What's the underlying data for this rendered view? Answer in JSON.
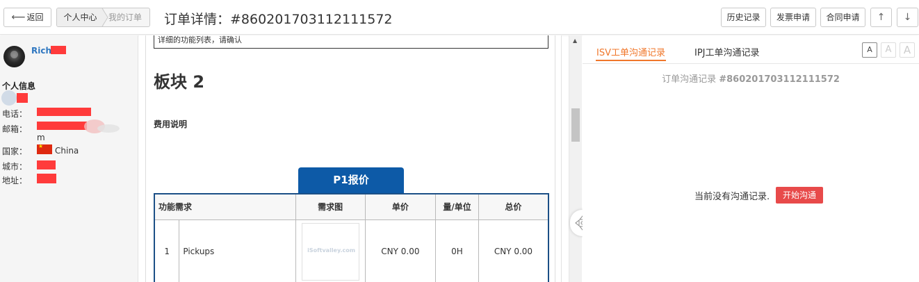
{
  "topbar": {
    "back_label": "返回",
    "breadcrumb": [
      "个人中心",
      "我的订单"
    ],
    "title": "订单详情：#860201703112111572",
    "buttons": {
      "history": "历史记录",
      "invoice": "发票申请",
      "contract": "合同申请",
      "up": "↑",
      "down": "↓"
    }
  },
  "sidebar": {
    "user_name": "Rich",
    "section_title": "个人信息",
    "labels": {
      "phone": "电话：",
      "email": "邮箱：",
      "country": "国家：",
      "city": "城市：",
      "address": "地址："
    },
    "email_tail": "m",
    "country": "China"
  },
  "document": {
    "note": "详细的功能列表，请确认",
    "block_title": "板块 2",
    "fee_title": "费用说明",
    "price_tab": "P1报价",
    "table": {
      "headers": [
        "功能需求",
        "需求图",
        "单价",
        "量/单位",
        "总价"
      ],
      "rows": [
        {
          "index": "1",
          "name": "Pickups",
          "image_text": "iSoftvalley.com",
          "unit_price": "CNY 0.00",
          "quantity": "0H",
          "total": "CNY 0.00"
        }
      ]
    }
  },
  "comm": {
    "tabs": [
      "ISV工单沟通记录",
      "IPJ工单沟通记录"
    ],
    "font_sizes": [
      "A",
      "A",
      "A"
    ],
    "heading_prefix": "订单沟通记录",
    "heading_id": "#860201703112111572",
    "empty_text": "当前没有沟通记录.",
    "start_button": "开始沟通"
  },
  "colors": {
    "accent_orange": "#f0772b",
    "primary_blue": "#0d5aa7",
    "danger_red": "#e84a4a",
    "link_blue": "#2f77c0"
  }
}
